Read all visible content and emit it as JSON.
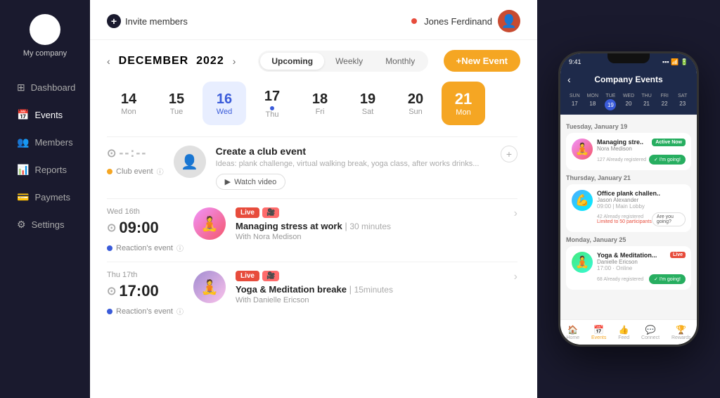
{
  "sidebar": {
    "company": "My company",
    "items": [
      {
        "label": "Dashboard",
        "icon": "⊞",
        "active": false
      },
      {
        "label": "Events",
        "icon": "📅",
        "active": true
      },
      {
        "label": "Members",
        "icon": "👥",
        "active": false
      },
      {
        "label": "Reports",
        "icon": "📊",
        "active": false
      },
      {
        "label": "Paymets",
        "icon": "💳",
        "active": false
      },
      {
        "label": "Settings",
        "icon": "⚙",
        "active": false
      }
    ]
  },
  "header": {
    "invite_label": "Invite members",
    "user_name": "Jones Ferdinand"
  },
  "calendar": {
    "month": "DECEMBER",
    "year": "2022",
    "view_tabs": [
      "Upcoming",
      "Weekly",
      "Monthly"
    ],
    "active_tab": "Upcoming",
    "new_event_label": "+New Event",
    "dates": [
      {
        "num": "14",
        "day": "Mon"
      },
      {
        "num": "15",
        "day": "Tue"
      },
      {
        "num": "16",
        "day": "Wed",
        "active": true
      },
      {
        "num": "17",
        "day": "Thu",
        "dot": true
      },
      {
        "num": "18",
        "day": "Fri"
      },
      {
        "num": "19",
        "day": "Sat"
      },
      {
        "num": "20",
        "day": "Sun"
      },
      {
        "num": "21",
        "day": "Mon",
        "highlight": true
      }
    ]
  },
  "events": [
    {
      "type": "create",
      "time_display": "--:--",
      "title": "Create a club event",
      "ideas": "Ideas: plank challenge, virtual walking break, yoga class, after works drinks...",
      "label": "Club event",
      "watch_label": "Watch video"
    },
    {
      "type": "event",
      "date_label": "Wed 16th",
      "time": "09:00",
      "live": true,
      "title": "Managing stress at work",
      "duration": "30 minutes",
      "host": "With Nora Medison",
      "label": "Reaction's event"
    },
    {
      "type": "event",
      "date_label": "Thu 17th",
      "time": "17:00",
      "live": true,
      "title": "Yoga & Meditation breake",
      "duration": "15minutes",
      "host": "With Danielle Ericson",
      "label": "Reaction's event"
    }
  ],
  "phone": {
    "time": "9:41",
    "title": "Company Events",
    "back_label": "‹",
    "mini_cal": {
      "day_headers": [
        "SUN",
        "MON",
        "TUE",
        "WED",
        "THU",
        "FRI",
        "SAT"
      ],
      "days": [
        "17",
        "18",
        "19",
        "20",
        "21",
        "22",
        "23"
      ],
      "today_index": 2
    },
    "events": [
      {
        "date_label": "Tuesday, January 19",
        "cards": [
          {
            "title": "Managing stre..",
            "host": "Nora Medison",
            "badge": "Active Now",
            "registered": "127 Already registered",
            "going": "✓ I'm going!",
            "going_active": true
          }
        ]
      },
      {
        "date_label": "Thursday, January 21",
        "cards": [
          {
            "title": "Office plank challen..",
            "host": "Jason Alexander",
            "time": "09:00 | Main Lobby",
            "registered": "42 Already registered",
            "limit_label": "Limited to 50 participants",
            "going": "Are you going?",
            "going_active": false
          }
        ]
      },
      {
        "date_label": "Monday, January 25",
        "cards": [
          {
            "title": "Yoga & Meditation...",
            "host": "Danielle Ericson",
            "time": "17:00 · Online",
            "live": true,
            "registered": "68 Already registered",
            "going": "✓ I'm going!",
            "going_active": true
          }
        ]
      }
    ],
    "nav_items": [
      {
        "icon": "🏠",
        "label": "Home"
      },
      {
        "icon": "📅",
        "label": "Events",
        "active": true
      },
      {
        "icon": "👍",
        "label": "Feed"
      },
      {
        "icon": "💬",
        "label": "Connect"
      },
      {
        "icon": "🏆",
        "label": "Rewards"
      }
    ]
  }
}
